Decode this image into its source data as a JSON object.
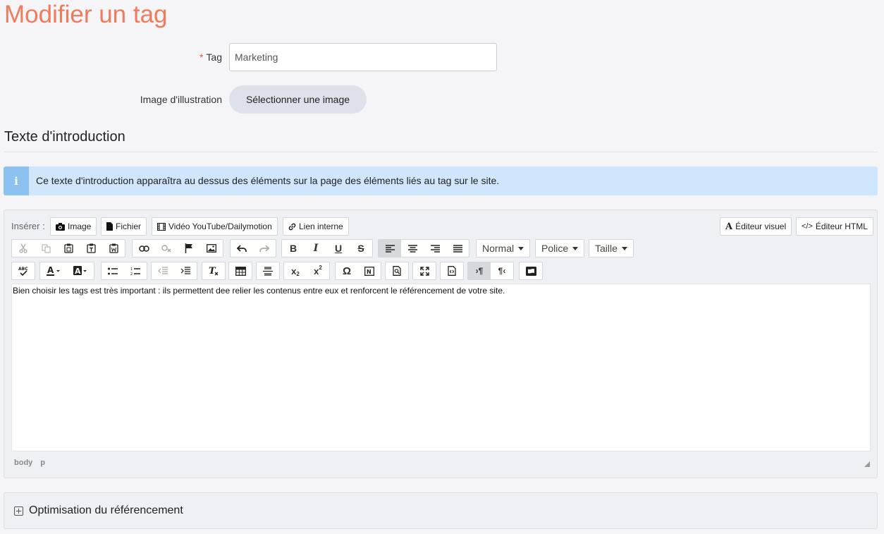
{
  "page": {
    "title": "Modifier un tag"
  },
  "form": {
    "tag_label": "Tag",
    "tag_required_mark": "*",
    "tag_value": "Marketing",
    "image_label": "Image d'illustration",
    "image_button": "Sélectionner une image"
  },
  "intro": {
    "heading": "Texte d'introduction",
    "info_icon": "info-icon",
    "info_text": "Ce texte d'introduction apparaîtra au dessus des éléments sur la page des éléments liés au tag sur le site."
  },
  "editor": {
    "insert_label": "Insérer :",
    "insert_buttons": [
      "Image",
      "Fichier",
      "Vidéo YouTube/Dailymotion",
      "Lien interne"
    ],
    "mode_buttons": [
      "Éditeur visuel",
      "Éditeur HTML"
    ],
    "dropdowns": {
      "format": "Normal",
      "font": "Police",
      "size": "Taille"
    },
    "content": "Bien choisir les tags est très important : ils permettent dee relier les contenus entre eux et renforcent le référencement de votre site.",
    "path": [
      "body",
      "p"
    ]
  },
  "seo": {
    "label": "Optimisation du référencement"
  },
  "colors": {
    "accent": "#f07a5c",
    "info_bg": "#cfe6fc",
    "info_icon_bg": "#8cc1f0"
  }
}
